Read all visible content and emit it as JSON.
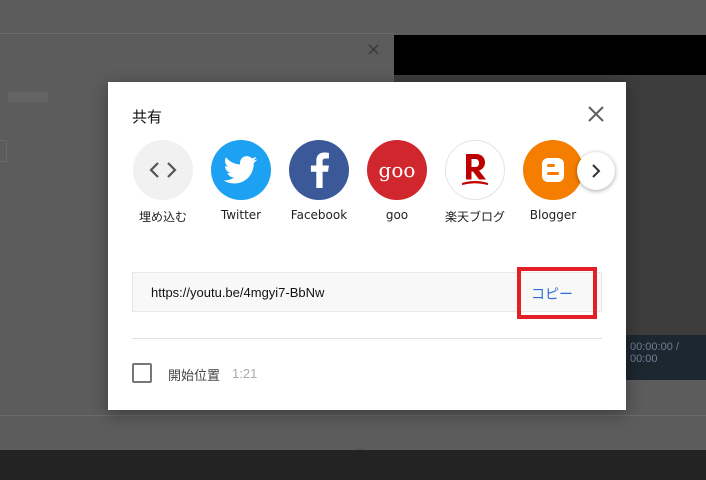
{
  "background": {
    "video_time": "00:00:00 / 00:00",
    "close_glyph": "×"
  },
  "dialog": {
    "title": "共有",
    "close_icon": "close-icon",
    "share_targets": [
      {
        "label": "埋め込む",
        "icon": "embed-code-icon",
        "color": "#f1f1f1"
      },
      {
        "label": "Twitter",
        "icon": "twitter-bird-icon",
        "color": "#1da1f2"
      },
      {
        "label": "Facebook",
        "icon": "facebook-f-icon",
        "color": "#3b5998"
      },
      {
        "label": "goo",
        "icon": "goo-logo-icon",
        "color": "#d0262e",
        "logo_text": "goo"
      },
      {
        "label": "楽天ブログ",
        "icon": "rakuten-r-icon",
        "color": "#ffffff"
      },
      {
        "label": "Blogger",
        "icon": "blogger-b-icon",
        "color": "#f57d00"
      }
    ],
    "next_icon": "chevron-right-icon",
    "share_url": "https://youtu.be/4mgyi7-BbNw",
    "copy_label": "コピー",
    "highlight_color": "#e41e26",
    "start_at_label": "開始位置",
    "start_at_time": "1:21",
    "start_at_checked": false
  }
}
